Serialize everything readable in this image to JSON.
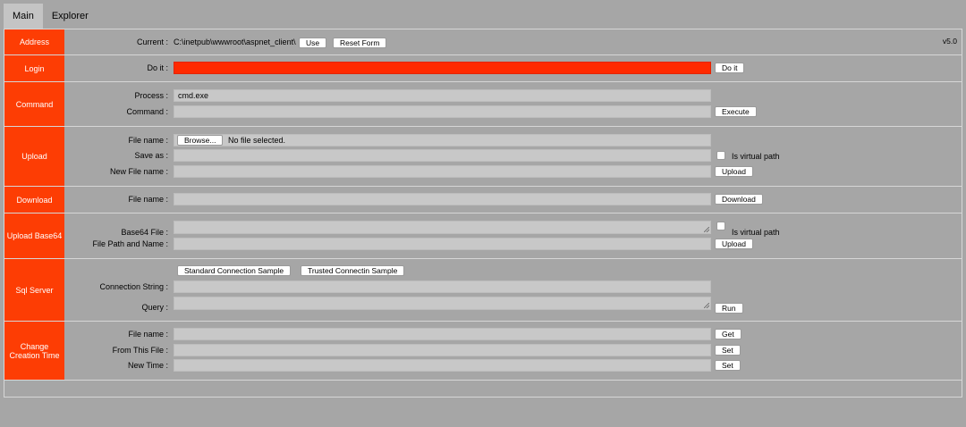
{
  "tabs": {
    "main": "Main",
    "explorer": "Explorer"
  },
  "version": "v5.0",
  "address": {
    "label": "Address",
    "current_label": "Current :",
    "current_value": "C:\\inetpub\\wwwroot\\aspnet_client\\",
    "use_btn": "Use",
    "reset_btn": "Reset Form"
  },
  "login": {
    "label": "Login",
    "doit_label": "Do it :",
    "doit_btn": "Do it"
  },
  "command": {
    "label": "Command",
    "process_label": "Process :",
    "process_value": "cmd.exe",
    "command_label": "Command :",
    "execute_btn": "Execute"
  },
  "upload": {
    "label": "Upload",
    "file_label": "File name :",
    "browse_btn": "Browse...",
    "no_file": "No file selected.",
    "save_as_label": "Save as :",
    "virtual_label": "Is virtual path",
    "new_file_label": "New File name :",
    "upload_btn": "Upload"
  },
  "download": {
    "label": "Download",
    "file_label": "File name :",
    "download_btn": "Download"
  },
  "upload_b64": {
    "label": "Upload Base64",
    "b64_label": "Base64 File :",
    "virtual_label": "Is virtual path",
    "path_label": "File Path and Name :",
    "upload_btn": "Upload"
  },
  "sql": {
    "label": "Sql Server",
    "std_btn": "Standard Connection Sample",
    "trusted_btn": "Trusted Connectin Sample",
    "conn_label": "Connection String :",
    "query_label": "Query :",
    "run_btn": "Run"
  },
  "ctime": {
    "label_line1": "Change",
    "label_line2": "Creation Time",
    "file_label": "File name :",
    "get_btn": "Get",
    "from_label": "From This File :",
    "set_btn1": "Set",
    "newtime_label": "New Time :",
    "set_btn2": "Set"
  },
  "colors": {
    "section_label_bg": "#fd3d04",
    "active_input_bg": "#ff2a00",
    "page_bg": "#a6a6a6"
  }
}
